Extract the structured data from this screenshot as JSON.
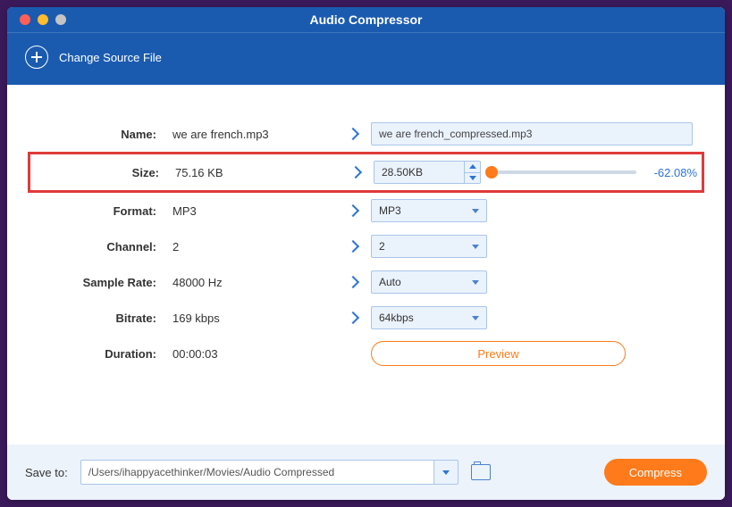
{
  "window": {
    "title": "Audio Compressor"
  },
  "toolbar": {
    "change_source_label": "Change Source File"
  },
  "rows": {
    "name": {
      "label": "Name:",
      "orig": "we are french.mp3",
      "target": "we are french_compressed.mp3"
    },
    "size": {
      "label": "Size:",
      "orig": "75.16 KB",
      "target": "28.50KB",
      "delta": "-62.08%"
    },
    "format": {
      "label": "Format:",
      "orig": "MP3",
      "target": "MP3"
    },
    "channel": {
      "label": "Channel:",
      "orig": "2",
      "target": "2"
    },
    "sample_rate": {
      "label": "Sample Rate:",
      "orig": "48000 Hz",
      "target": "Auto"
    },
    "bitrate": {
      "label": "Bitrate:",
      "orig": "169 kbps",
      "target": "64kbps"
    },
    "duration": {
      "label": "Duration:",
      "orig": "00:00:03"
    }
  },
  "preview_label": "Preview",
  "footer": {
    "save_to_label": "Save to:",
    "path": "/Users/ihappyacethinker/Movies/Audio Compressed",
    "compress_label": "Compress"
  }
}
